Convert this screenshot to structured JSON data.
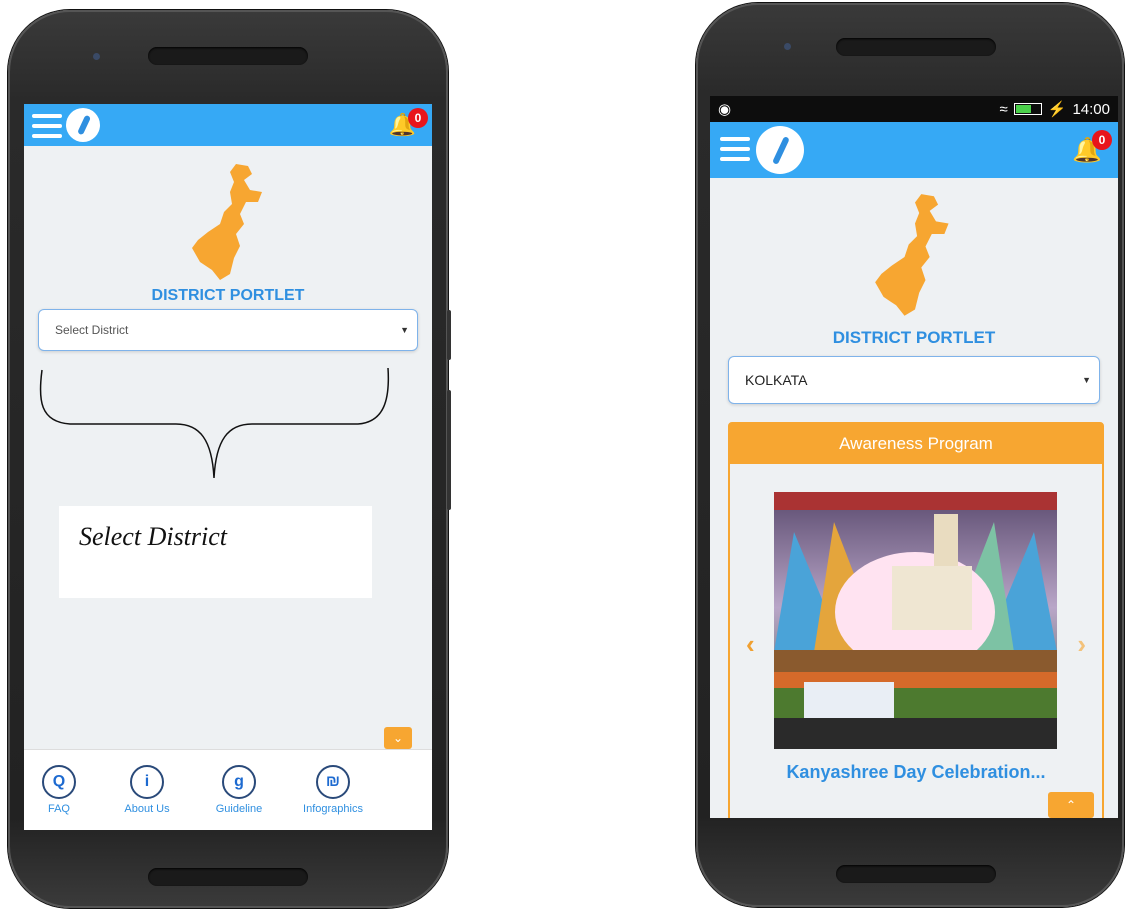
{
  "left_screen": {
    "portlet_title": "DISTRICT PORTLET",
    "select": {
      "value": "Select District"
    },
    "notification_count": "0",
    "annotation": "Select District",
    "scroll_down_icon": "chevron-down",
    "bottom_nav": [
      {
        "label": "FAQ",
        "icon": "Q"
      },
      {
        "label": "About Us",
        "icon": "i"
      },
      {
        "label": "Guideline",
        "icon": "g"
      },
      {
        "label": "Infographics",
        "icon": "₪"
      }
    ]
  },
  "right_screen": {
    "status_time": "14:00",
    "portlet_title": "DISTRICT PORTLET",
    "select": {
      "value": "KOLKATA"
    },
    "notification_count": "0",
    "card_title": "Awareness Program",
    "card_caption": "Kanyashree Day Celebration...",
    "scroll_up_icon": "chevron-up"
  },
  "colors": {
    "appbar": "#36a9f5",
    "accent_orange": "#f7a631",
    "title_blue": "#2f8fe0",
    "badge_red": "#e8141b"
  }
}
